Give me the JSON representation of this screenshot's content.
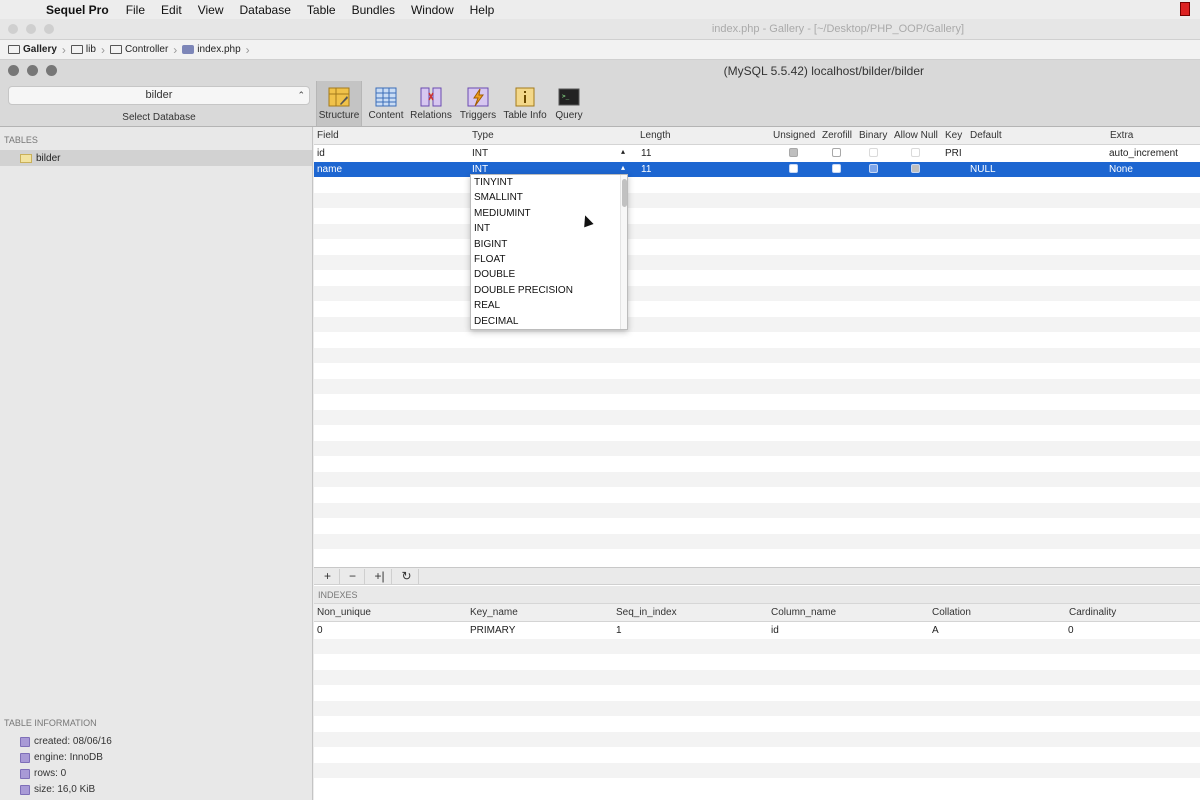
{
  "menubar": {
    "app_name": "Sequel Pro",
    "items": [
      "File",
      "Edit",
      "View",
      "Database",
      "Table",
      "Bundles",
      "Window",
      "Help"
    ]
  },
  "back_window": {
    "title": "index.php - Gallery - [~/Desktop/PHP_OOP/Gallery]",
    "breadcrumb": [
      "Gallery",
      "lib",
      "Controller",
      "index.php"
    ]
  },
  "window": {
    "title": "(MySQL 5.5.42) localhost/bilder/bilder"
  },
  "toolbar": {
    "database": "bilder",
    "database_label": "Select Database",
    "buttons": [
      "Structure",
      "Content",
      "Relations",
      "Triggers",
      "Table Info",
      "Query"
    ]
  },
  "sidebar": {
    "tables_header": "TABLES",
    "tables": [
      "bilder"
    ],
    "info_header": "TABLE INFORMATION",
    "info": [
      "created: 08/06/16",
      "engine: InnoDB",
      "rows: 0",
      "size: 16,0 KiB"
    ]
  },
  "structure": {
    "columns": [
      "Field",
      "Type",
      "Length",
      "Unsigned",
      "Zerofill",
      "Binary",
      "Allow Null",
      "Key",
      "Default",
      "Extra"
    ],
    "rows": [
      {
        "field": "id",
        "type": "INT",
        "length": "11",
        "key": "PRI",
        "default": "",
        "extra": "auto_increment"
      },
      {
        "field": "name",
        "type": "INT",
        "length": "11",
        "key": "",
        "default": "NULL",
        "extra": "None"
      }
    ]
  },
  "type_dropdown": {
    "options": [
      "TINYINT",
      "SMALLINT",
      "MEDIUMINT",
      "INT",
      "BIGINT",
      "FLOAT",
      "DOUBLE",
      "DOUBLE PRECISION",
      "REAL",
      "DECIMAL"
    ]
  },
  "field_tools": [
    "+",
    "−",
    "+|",
    "↻"
  ],
  "indexes": {
    "header": "INDEXES",
    "columns": [
      "Non_unique",
      "Key_name",
      "Seq_in_index",
      "Column_name",
      "Collation",
      "Cardinality"
    ],
    "rows": [
      {
        "non_unique": "0",
        "key_name": "PRIMARY",
        "seq": "1",
        "column": "id",
        "collation": "A",
        "cardinality": "0"
      }
    ]
  }
}
